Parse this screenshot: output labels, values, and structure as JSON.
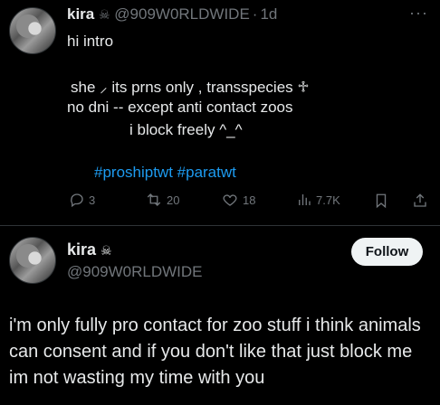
{
  "tweet1": {
    "name": "kira",
    "name_icon": "☠",
    "handle": "@909W0RLDWIDE",
    "separator": "·",
    "time": "1d",
    "more": "···",
    "lines": [
      "hi  intro",
      "she  ⸝  its  prns only , transspecies ♱",
      "no  dni --   except anti  contact zoos",
      "i block freely ^_^"
    ],
    "hashtags": "#proshiptwt #paratwt",
    "stats": {
      "replies": "3",
      "reposts": "20",
      "likes": "18",
      "views": "7.7K"
    }
  },
  "tweet2": {
    "name": "kira",
    "name_icon": "☠",
    "handle": "@909W0RLDWIDE",
    "follow_label": "Follow",
    "body": "i'm only fully pro contact for zoo stuff i think animals can consent and if you don't like that just block me im not wasting my time with you"
  },
  "colors": {
    "background": "#000000",
    "text": "#e7e9ea",
    "muted": "#71767b",
    "accent": "#1d9bf0"
  }
}
